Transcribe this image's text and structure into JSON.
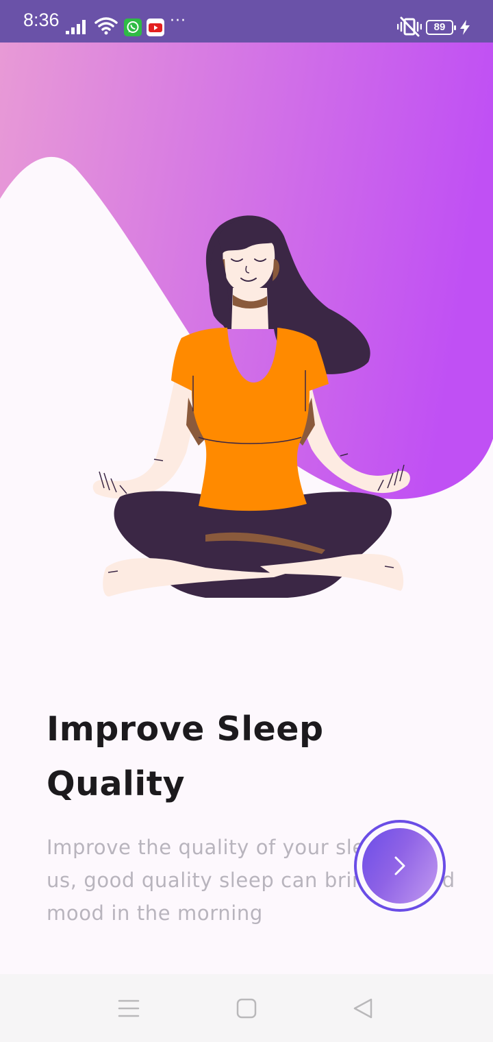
{
  "status_bar": {
    "time": "8:36",
    "battery_level": "89",
    "overflow_indicator": "···",
    "icons": [
      "signal-icon",
      "wifi-icon",
      "whatsapp-icon",
      "youtube-icon",
      "vibrate-icon",
      "battery-icon",
      "charging-icon"
    ]
  },
  "onboarding": {
    "title": "Improve Sleep Quality",
    "description": "Improve the quality of your sleep with us, good quality sleep can bring a good mood in the morning",
    "next_icon": "chevron-right-icon"
  },
  "colors": {
    "status_bar": "#6a52a8",
    "gradient_start": "#e89ad6",
    "gradient_end": "#c050f4",
    "accent": "#6a4de6",
    "title": "#1c1a1d",
    "description": "#b8b4bd",
    "shirt": "#ff8a00",
    "hair": "#3b2745"
  },
  "nav_bar": {
    "buttons": [
      "menu-icon",
      "home-icon",
      "back-icon"
    ]
  }
}
